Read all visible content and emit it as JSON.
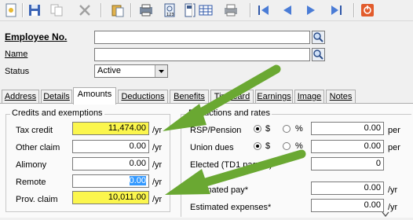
{
  "toolbar": {
    "icons": [
      "new-record-icon",
      "save-icon",
      "copy-icon",
      "delete-icon",
      "paste-icon",
      "print-preview-icon",
      "calculator-icon",
      "table-icon",
      "printer-icon",
      "first-record-icon",
      "previous-record-icon",
      "next-record-icon",
      "last-record-icon",
      "exit-icon"
    ]
  },
  "header": {
    "employee_no_label": "Employee No.",
    "employee_no_value": "",
    "name_label": "Name",
    "name_value": "",
    "status_label": "Status",
    "status_value": "Active"
  },
  "tabs": [
    "Address",
    "Details",
    "Amounts",
    "Deductions",
    "Benefits",
    "Timecard",
    "Earnings",
    "Image",
    "Notes"
  ],
  "active_tab": "Amounts",
  "credits": {
    "title": "Credits and exemptions",
    "rows": [
      {
        "label": "Tax credit",
        "value": "11,474.00",
        "unit": "/yr",
        "highlight": true
      },
      {
        "label": "Other claim",
        "value": "0.00",
        "unit": "/yr",
        "highlight": false
      },
      {
        "label": "Alimony",
        "value": "0.00",
        "unit": "/yr",
        "highlight": false
      },
      {
        "label": "Remote",
        "value": "0.00",
        "unit": "/yr",
        "highlight": false
      },
      {
        "label": "Prov. claim",
        "value": "10,011.00",
        "unit": "/yr",
        "highlight": true
      }
    ]
  },
  "deductions": {
    "title": "Deductions and rates",
    "rsp_label": "RSP/Pension",
    "rsp_value": "0.00",
    "union_label": "Union dues",
    "union_value": "0.00",
    "dollar_label": "$",
    "percent_label": "%",
    "per_label": "per",
    "elected_label": "Elected (TD1 page 1)",
    "elected_value": "0",
    "est_pay_label": "Estimated pay*",
    "est_pay_value": "0.00",
    "est_exp_label": "Estimated expenses*",
    "est_exp_value": "0.00",
    "yr_label": "/yr"
  },
  "colors": {
    "highlight": "#fbf64d",
    "arrow": "#6aa832"
  }
}
